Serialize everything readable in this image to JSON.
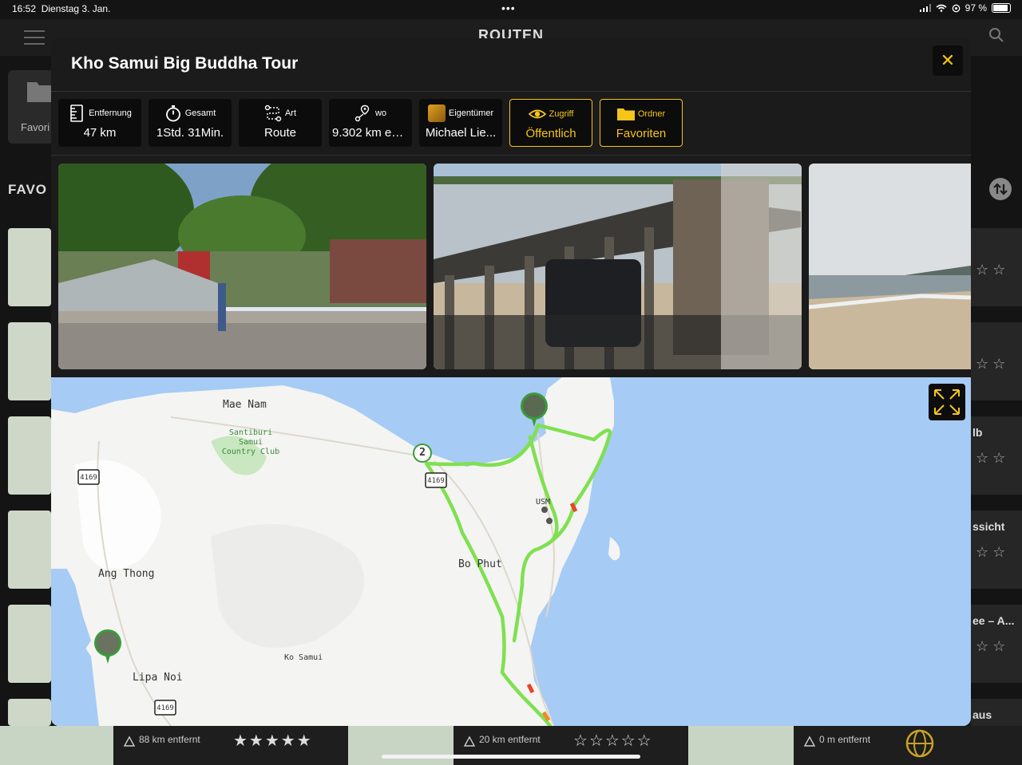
{
  "status_bar": {
    "time": "16:52",
    "date": "Dienstag 3. Jan.",
    "battery": "97 %",
    "more": "•••"
  },
  "background": {
    "title": "ROUTEN",
    "favorites_tile_label": "Favori",
    "section_label": "FAVO",
    "right_titles": [
      "lb",
      "ssicht",
      "ee – A...",
      "aus"
    ],
    "right_stars": "☆ ☆",
    "bottom": {
      "dist1": "88 km entfernt",
      "dist2": "20 km entfernt",
      "dist3": "0 m entfernt",
      "stars_full": "★★★★★",
      "stars_empty": "☆☆☆☆☆"
    }
  },
  "modal": {
    "title": "Kho Samui Big Buddha Tour",
    "close_label": "✕",
    "chips": [
      {
        "label": "Entfernung",
        "value": "47 km",
        "icon": "ruler-icon"
      },
      {
        "label": "Gesamt",
        "value": "1Std. 31Min.",
        "icon": "stopwatch-icon"
      },
      {
        "label": "Art",
        "value": "Route",
        "icon": "route-icon"
      },
      {
        "label": "wo",
        "value": "9.302 km entfernt",
        "icon": "location-distance-icon"
      },
      {
        "label": "Eigentümer",
        "value": "Michael Lie...",
        "icon": "owner-avatar-icon"
      },
      {
        "label": "Zugriff",
        "value": "Öffentlich",
        "icon": "eye-icon"
      },
      {
        "label": "Ordner",
        "value": "Favoriten",
        "icon": "folder-icon"
      }
    ],
    "colors": {
      "accent": "#f5c518",
      "route": "#7fe050",
      "route_warn": "#e8442a",
      "water": "#a6cbf4"
    }
  },
  "map": {
    "labels": {
      "mae_nam": "Mae Nam",
      "santiburi": "Santiburi Samui Country Club",
      "ang_thong": "Ang Thong",
      "bo_phut": "Bo Phut",
      "lipa_noi": "Lipa Noi",
      "ko_samui": "Ko Samui",
      "usm": "USM",
      "road1": "4169",
      "road2": "4169",
      "road3": "4169",
      "waypoint": "2"
    }
  }
}
